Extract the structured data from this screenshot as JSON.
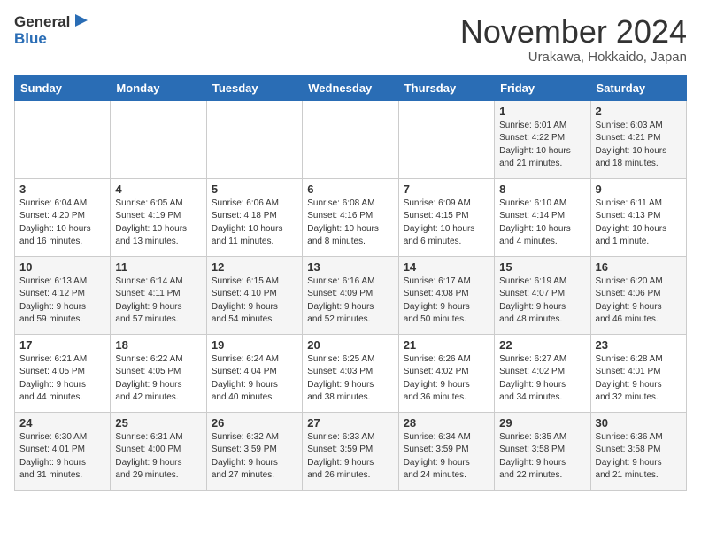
{
  "header": {
    "logo_general": "General",
    "logo_blue": "Blue",
    "month": "November 2024",
    "location": "Urakawa, Hokkaido, Japan"
  },
  "weekdays": [
    "Sunday",
    "Monday",
    "Tuesday",
    "Wednesday",
    "Thursday",
    "Friday",
    "Saturday"
  ],
  "weeks": [
    [
      {
        "num": "",
        "info": ""
      },
      {
        "num": "",
        "info": ""
      },
      {
        "num": "",
        "info": ""
      },
      {
        "num": "",
        "info": ""
      },
      {
        "num": "",
        "info": ""
      },
      {
        "num": "1",
        "info": "Sunrise: 6:01 AM\nSunset: 4:22 PM\nDaylight: 10 hours\nand 21 minutes."
      },
      {
        "num": "2",
        "info": "Sunrise: 6:03 AM\nSunset: 4:21 PM\nDaylight: 10 hours\nand 18 minutes."
      }
    ],
    [
      {
        "num": "3",
        "info": "Sunrise: 6:04 AM\nSunset: 4:20 PM\nDaylight: 10 hours\nand 16 minutes."
      },
      {
        "num": "4",
        "info": "Sunrise: 6:05 AM\nSunset: 4:19 PM\nDaylight: 10 hours\nand 13 minutes."
      },
      {
        "num": "5",
        "info": "Sunrise: 6:06 AM\nSunset: 4:18 PM\nDaylight: 10 hours\nand 11 minutes."
      },
      {
        "num": "6",
        "info": "Sunrise: 6:08 AM\nSunset: 4:16 PM\nDaylight: 10 hours\nand 8 minutes."
      },
      {
        "num": "7",
        "info": "Sunrise: 6:09 AM\nSunset: 4:15 PM\nDaylight: 10 hours\nand 6 minutes."
      },
      {
        "num": "8",
        "info": "Sunrise: 6:10 AM\nSunset: 4:14 PM\nDaylight: 10 hours\nand 4 minutes."
      },
      {
        "num": "9",
        "info": "Sunrise: 6:11 AM\nSunset: 4:13 PM\nDaylight: 10 hours\nand 1 minute."
      }
    ],
    [
      {
        "num": "10",
        "info": "Sunrise: 6:13 AM\nSunset: 4:12 PM\nDaylight: 9 hours\nand 59 minutes."
      },
      {
        "num": "11",
        "info": "Sunrise: 6:14 AM\nSunset: 4:11 PM\nDaylight: 9 hours\nand 57 minutes."
      },
      {
        "num": "12",
        "info": "Sunrise: 6:15 AM\nSunset: 4:10 PM\nDaylight: 9 hours\nand 54 minutes."
      },
      {
        "num": "13",
        "info": "Sunrise: 6:16 AM\nSunset: 4:09 PM\nDaylight: 9 hours\nand 52 minutes."
      },
      {
        "num": "14",
        "info": "Sunrise: 6:17 AM\nSunset: 4:08 PM\nDaylight: 9 hours\nand 50 minutes."
      },
      {
        "num": "15",
        "info": "Sunrise: 6:19 AM\nSunset: 4:07 PM\nDaylight: 9 hours\nand 48 minutes."
      },
      {
        "num": "16",
        "info": "Sunrise: 6:20 AM\nSunset: 4:06 PM\nDaylight: 9 hours\nand 46 minutes."
      }
    ],
    [
      {
        "num": "17",
        "info": "Sunrise: 6:21 AM\nSunset: 4:05 PM\nDaylight: 9 hours\nand 44 minutes."
      },
      {
        "num": "18",
        "info": "Sunrise: 6:22 AM\nSunset: 4:05 PM\nDaylight: 9 hours\nand 42 minutes."
      },
      {
        "num": "19",
        "info": "Sunrise: 6:24 AM\nSunset: 4:04 PM\nDaylight: 9 hours\nand 40 minutes."
      },
      {
        "num": "20",
        "info": "Sunrise: 6:25 AM\nSunset: 4:03 PM\nDaylight: 9 hours\nand 38 minutes."
      },
      {
        "num": "21",
        "info": "Sunrise: 6:26 AM\nSunset: 4:02 PM\nDaylight: 9 hours\nand 36 minutes."
      },
      {
        "num": "22",
        "info": "Sunrise: 6:27 AM\nSunset: 4:02 PM\nDaylight: 9 hours\nand 34 minutes."
      },
      {
        "num": "23",
        "info": "Sunrise: 6:28 AM\nSunset: 4:01 PM\nDaylight: 9 hours\nand 32 minutes."
      }
    ],
    [
      {
        "num": "24",
        "info": "Sunrise: 6:30 AM\nSunset: 4:01 PM\nDaylight: 9 hours\nand 31 minutes."
      },
      {
        "num": "25",
        "info": "Sunrise: 6:31 AM\nSunset: 4:00 PM\nDaylight: 9 hours\nand 29 minutes."
      },
      {
        "num": "26",
        "info": "Sunrise: 6:32 AM\nSunset: 3:59 PM\nDaylight: 9 hours\nand 27 minutes."
      },
      {
        "num": "27",
        "info": "Sunrise: 6:33 AM\nSunset: 3:59 PM\nDaylight: 9 hours\nand 26 minutes."
      },
      {
        "num": "28",
        "info": "Sunrise: 6:34 AM\nSunset: 3:59 PM\nDaylight: 9 hours\nand 24 minutes."
      },
      {
        "num": "29",
        "info": "Sunrise: 6:35 AM\nSunset: 3:58 PM\nDaylight: 9 hours\nand 22 minutes."
      },
      {
        "num": "30",
        "info": "Sunrise: 6:36 AM\nSunset: 3:58 PM\nDaylight: 9 hours\nand 21 minutes."
      }
    ]
  ]
}
